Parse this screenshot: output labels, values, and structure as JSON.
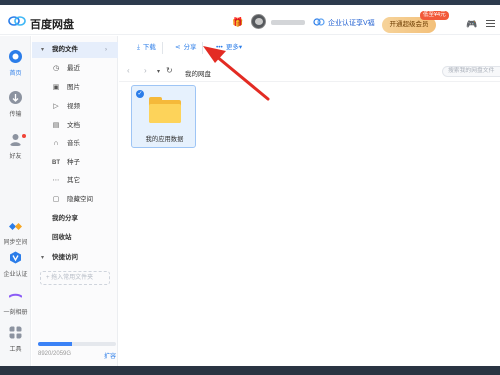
{
  "titlebar": {
    "app_title": "百度网盘",
    "verify_text": "企业认证享V福",
    "vip_button": "开通超级会员",
    "vip_badge": "低至¥4元"
  },
  "rail": {
    "items": [
      {
        "label": "首页",
        "icon": "cloud-home-icon",
        "active": true
      },
      {
        "label": "传输",
        "icon": "transfer-icon"
      },
      {
        "label": "好友",
        "icon": "friends-icon"
      },
      {
        "label": "同步空间",
        "icon": "sync-space-icon"
      },
      {
        "label": "企业认证",
        "icon": "enterprise-v-icon"
      },
      {
        "label": "一刻相册",
        "icon": "album-icon"
      },
      {
        "label": "工具",
        "icon": "tools-icon"
      }
    ]
  },
  "sidebar": {
    "my_files": "我的文件",
    "items": [
      {
        "label": "最近",
        "icon": "clock-icon"
      },
      {
        "label": "图片",
        "icon": "image-icon"
      },
      {
        "label": "视频",
        "icon": "video-icon"
      },
      {
        "label": "文档",
        "icon": "document-icon"
      },
      {
        "label": "音乐",
        "icon": "headphones-icon"
      },
      {
        "label": "种子",
        "icon": "bt-icon",
        "glyph": "BT"
      },
      {
        "label": "其它",
        "icon": "other-icon"
      },
      {
        "label": "隐藏空间",
        "icon": "lock-icon"
      }
    ],
    "my_share": "我的分享",
    "recycle": "回收站",
    "quick_access": "快捷访问",
    "add_quick": "+ 拖入常用文件夹",
    "storage_text": "8920/2059G",
    "storage_expand": "扩容",
    "storage_used_fraction": 0.43
  },
  "toolbar": {
    "download": "下载",
    "share": "分享",
    "more": "更多"
  },
  "breadcrumb": {
    "root": "我的网盘",
    "search_placeholder": "搜索我的网盘文件"
  },
  "files": [
    {
      "name": "我的应用数据",
      "type": "folder",
      "selected": true
    }
  ],
  "colors": {
    "accent": "#2b7de9",
    "annotation_arrow": "#e32b23",
    "folder": "#fdd35a"
  }
}
